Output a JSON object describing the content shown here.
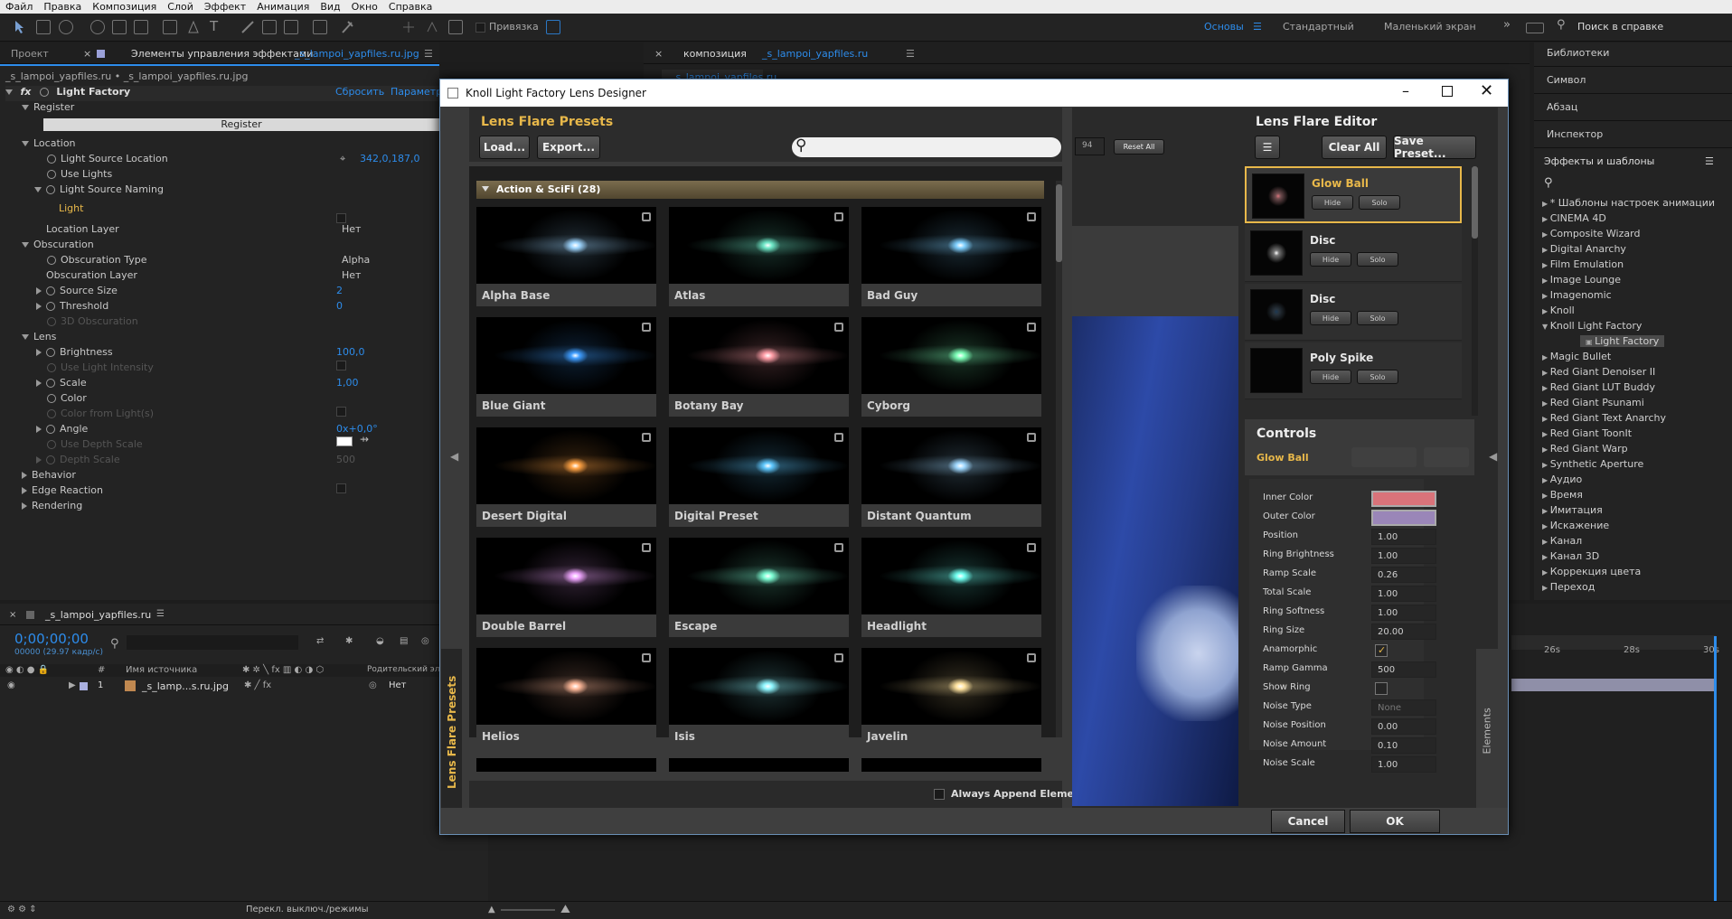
{
  "menubar": [
    "Файл",
    "Правка",
    "Композиция",
    "Слой",
    "Эффект",
    "Анимация",
    "Вид",
    "Окно",
    "Справка"
  ],
  "toolbar": {
    "snap_label": "Привязка",
    "workspaces": [
      "Основы",
      "Стандартный",
      "Маленький экран"
    ],
    "help_search": "Поиск в справке"
  },
  "left_tabs": {
    "project": "Проект",
    "effects": "Элементы управления эффектами",
    "effects_file": "_s_lampoi_yapfiles.ru.jpg"
  },
  "effect_controls": {
    "breadcrumb": "_s_lampoi_yapfiles.ru • _s_lampoi_yapfiles.ru.jpg",
    "effect_name": "Light Factory",
    "reset": "Сбросить",
    "params": "Параметры",
    "register_group": "Register",
    "register_button": "Register",
    "location": "Location",
    "light_source_location": "Light Source Location",
    "light_source_location_value": "342,0,187,0",
    "use_lights": "Use Lights",
    "light_source_naming": "Light Source Naming",
    "light_label": "Light",
    "location_layer": "Location Layer",
    "location_layer_value": "Нет",
    "obscuration": "Obscuration",
    "obscuration_type": "Obscuration Type",
    "obscuration_type_value": "Alpha",
    "obscuration_layer": "Obscuration Layer",
    "obscuration_layer_value": "Нет",
    "source_size": "Source Size",
    "source_size_value": "2",
    "threshold": "Threshold",
    "threshold_value": "0",
    "obscuration_3d": "3D Obscuration",
    "lens": "Lens",
    "brightness": "Brightness",
    "brightness_value": "100,0",
    "use_light_intensity": "Use Light Intensity",
    "scale": "Scale",
    "scale_value": "1,00",
    "color": "Color",
    "color_from_light": "Color from Light(s)",
    "angle": "Angle",
    "angle_value": "0x+0,0°",
    "use_depth_scale": "Use Depth Scale",
    "depth_scale": "Depth Scale",
    "depth_scale_value": "500",
    "behavior": "Behavior",
    "edge_reaction": "Edge Reaction",
    "rendering": "Rendering"
  },
  "comp_tab": {
    "label": "композиция",
    "name": "_s_lampoi_yapfiles.ru",
    "subtab": "_s_lampoi_yapfiles.ru"
  },
  "right_panel": {
    "sections": [
      "Библиотеки",
      "Символ",
      "Абзац",
      "Инспектор"
    ],
    "effects_title": "Эффекты и шаблоны",
    "tree": [
      "* Шаблоны настроек анимации",
      "CINEMA 4D",
      "Composite Wizard",
      "Digital Anarchy",
      "Film Emulation",
      "Image Lounge",
      "Imagenomic",
      "Knoll",
      "Knoll Light Factory",
      "Light Factory",
      "Magic Bullet",
      "Red Giant Denoiser II",
      "Red Giant LUT Buddy",
      "Red Giant Psunami",
      "Red Giant Text Anarchy",
      "Red Giant ToonIt",
      "Red Giant Warp",
      "Synthetic Aperture",
      "Аудио",
      "Время",
      "Имитация",
      "Искажение",
      "Канал",
      "Канал 3D",
      "Коррекция цвета",
      "Переход"
    ]
  },
  "dialog": {
    "title": "Knoll Light Factory Lens Designer",
    "presets_title": "Lens Flare Presets",
    "load": "Load...",
    "export": "Export...",
    "search_placeholder": "",
    "category": "Action & SciFi (28)",
    "presets": [
      {
        "name": "Alpha Base",
        "color": "#9fd6ff"
      },
      {
        "name": "Atlas",
        "color": "#6fe8c8"
      },
      {
        "name": "Bad Guy",
        "color": "#7fd0ff"
      },
      {
        "name": "Blue Giant",
        "color": "#3f9dff"
      },
      {
        "name": "Botany Bay",
        "color": "#ff9fa8"
      },
      {
        "name": "Cyborg",
        "color": "#7dffb8"
      },
      {
        "name": "Desert Digital",
        "color": "#ffa244"
      },
      {
        "name": "Digital Preset",
        "color": "#5fc8ff"
      },
      {
        "name": "Distant Quantum",
        "color": "#9fd8ff"
      },
      {
        "name": "Double Barrel",
        "color": "#f0a6ff"
      },
      {
        "name": "Escape",
        "color": "#7fffd6"
      },
      {
        "name": "Headlight",
        "color": "#6ffff0"
      },
      {
        "name": "Helios",
        "color": "#ffb99a"
      },
      {
        "name": "Isis",
        "color": "#8ff6ff"
      },
      {
        "name": "Javelin",
        "color": "#ffe3a0"
      }
    ],
    "always_append": "Always Append Elements",
    "vertical_tab": "Lens Flare Presets",
    "preview_value": "94",
    "reset_all": "Reset All",
    "editor_title": "Lens Flare Editor",
    "clear_all": "Clear All",
    "save_preset": "Save Preset...",
    "hide": "Hide",
    "solo": "Solo",
    "layers": [
      "Glow Ball",
      "Disc",
      "Disc",
      "Poly Spike"
    ],
    "controls_title": "Controls",
    "selected_element": "Glow Ball",
    "elements_tab": "Elements",
    "controls": [
      {
        "label": "Inner Color",
        "value": ""
      },
      {
        "label": "Outer Color",
        "value": ""
      },
      {
        "label": "Position",
        "value": "1.00"
      },
      {
        "label": "Ring Brightness",
        "value": "1.00"
      },
      {
        "label": "Ramp Scale",
        "value": "0.26"
      },
      {
        "label": "Total Scale",
        "value": "1.00"
      },
      {
        "label": "Ring Softness",
        "value": "1.00"
      },
      {
        "label": "Ring Size",
        "value": "20.00"
      },
      {
        "label": "Anamorphic",
        "value": ""
      },
      {
        "label": "Ramp Gamma",
        "value": "500"
      },
      {
        "label": "Show Ring",
        "value": ""
      },
      {
        "label": "Noise Type",
        "value": "None"
      },
      {
        "label": "Noise Position",
        "value": "0.00"
      },
      {
        "label": "Noise Amount",
        "value": "0.10"
      },
      {
        "label": "Noise Scale",
        "value": "1.00"
      }
    ],
    "inner_color": "#d9737a",
    "outer_color": "#9a86b8",
    "cancel": "Cancel",
    "ok": "OK"
  },
  "timeline": {
    "tab": "_s_lampoi_yapfiles.ru",
    "timecode": "0;00;00;00",
    "fps": "00000 (29.97 кадр/с)",
    "col_source": "Имя источника",
    "col_parent": "Родительский элем",
    "layer_num": "1",
    "layer_name": "_s_lamp...s.ru.jpg",
    "layer_parent": "Нет",
    "ticks": [
      "26s",
      "28s",
      "30s"
    ],
    "bottom_label": "Перекл. выключ./режимы"
  }
}
